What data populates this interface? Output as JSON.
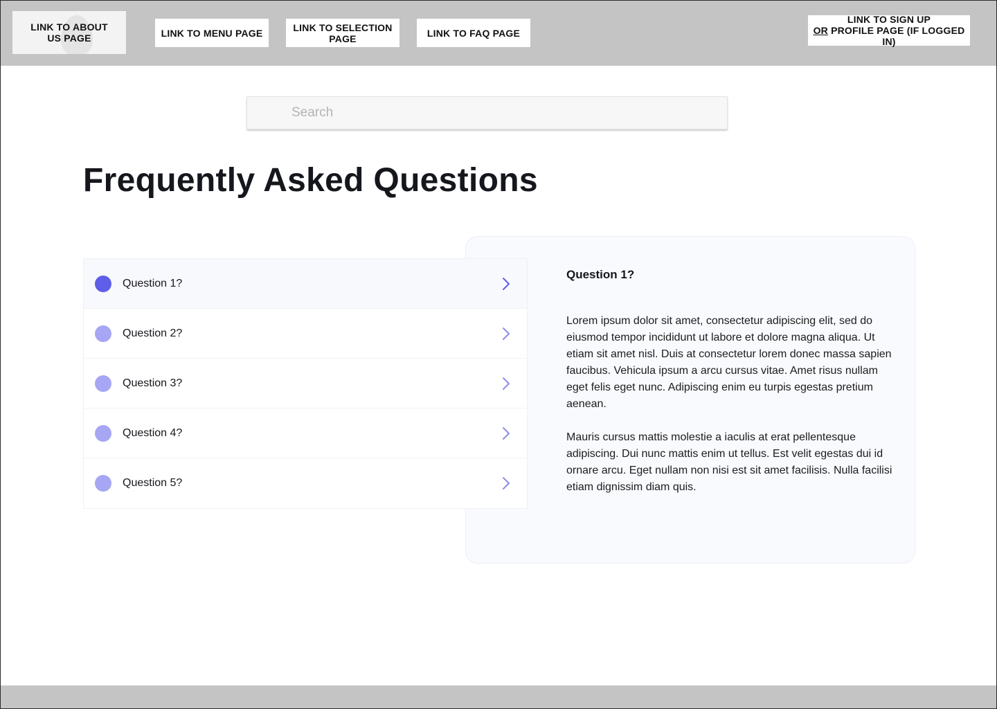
{
  "nav": {
    "about_line1": "LINK TO ABOUT",
    "about_line2": "US PAGE",
    "menu": "LINK TO MENU PAGE",
    "selection_line1": "LINK TO SELECTION",
    "selection_line2": "PAGE",
    "faq": "LINK TO FAQ PAGE",
    "signup_line1": "LINK TO SIGN UP",
    "signup_or": "OR",
    "signup_line2_rest": " PROFILE PAGE (IF LOGGED IN)"
  },
  "search": {
    "placeholder": "Search"
  },
  "page_title": "Frequently Asked Questions",
  "questions": [
    {
      "label": "Question 1?",
      "active": true
    },
    {
      "label": "Question 2?",
      "active": false
    },
    {
      "label": "Question 3?",
      "active": false
    },
    {
      "label": "Question 4?",
      "active": false
    },
    {
      "label": "Question 5?",
      "active": false
    }
  ],
  "answer": {
    "title": "Question 1?",
    "paragraph1": "Lorem ipsum dolor sit amet, consectetur adipiscing elit, sed do eiusmod tempor incididunt ut labore et dolore magna aliqua. Ut etiam sit amet nisl. Duis at consectetur lorem donec massa sapien faucibus. Vehicula ipsum a arcu cursus vitae. Amet risus nullam eget felis eget nunc. Adipiscing enim eu turpis egestas pretium aenean.",
    "paragraph2": "Mauris cursus mattis molestie a iaculis at erat pellentesque adipiscing. Dui nunc mattis enim ut tellus. Est velit egestas dui id ornare arcu. Eget nullam non nisi est sit amet facilisis. Nulla facilisi etiam dignissim diam quis."
  },
  "colors": {
    "accent_active": "#5e5ee9",
    "accent_inactive": "#a6a6f4",
    "bar_gray": "#c4c4c4"
  },
  "icons": {
    "question_chevron": "chevron-right-icon",
    "question_dot": "circle-icon",
    "logo": "droplet-icon"
  }
}
